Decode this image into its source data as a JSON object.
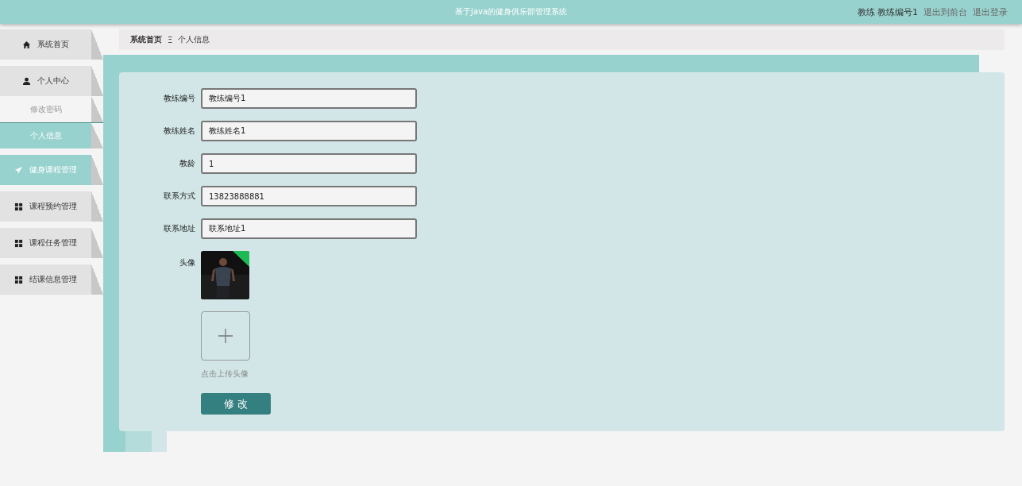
{
  "header": {
    "title": "基于Java的健身俱乐部管理系统",
    "user": "教练 教练编号1",
    "links": [
      "退出到前台",
      "退出登录"
    ]
  },
  "sidebar": {
    "items": [
      {
        "label": "系统首页",
        "hovered": false
      },
      {
        "label": "个人中心",
        "hovered": false,
        "children": [
          {
            "label": "修改密码",
            "selected": false
          },
          {
            "label": "个人信息",
            "selected": true
          }
        ]
      },
      {
        "label": "健身课程管理",
        "hovered": true
      },
      {
        "label": "课程预约管理",
        "hovered": false
      },
      {
        "label": "课程任务管理",
        "hovered": false
      },
      {
        "label": "结课信息管理",
        "hovered": false
      }
    ]
  },
  "breadcrumb": {
    "items": [
      "系统首页",
      "个人信息"
    ],
    "separator": "Ξ"
  },
  "form": {
    "fields": [
      {
        "label": "教练编号",
        "value": "教练编号1"
      },
      {
        "label": "教练姓名",
        "value": "教练姓名1"
      },
      {
        "label": "教龄",
        "value": "1"
      },
      {
        "label": "联系方式",
        "value": "13823888881"
      },
      {
        "label": "联系地址",
        "value": "联系地址1"
      }
    ],
    "avatar": {
      "label": "头像",
      "kind": "picture",
      "upload_hint": "点击上传头像"
    },
    "submit": "修 改"
  }
}
